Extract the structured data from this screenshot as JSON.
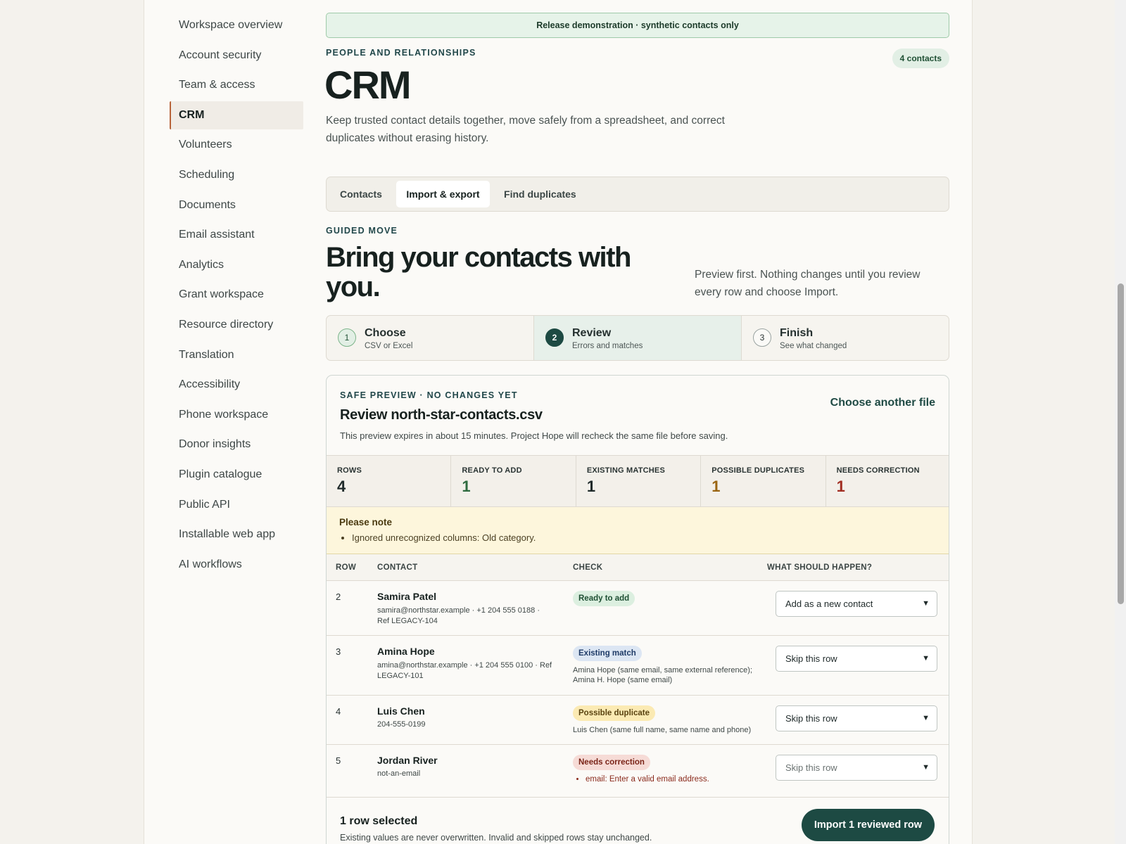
{
  "sidebar": {
    "items": [
      {
        "label": "Workspace overview"
      },
      {
        "label": "Account security"
      },
      {
        "label": "Team & access"
      },
      {
        "label": "CRM"
      },
      {
        "label": "Volunteers"
      },
      {
        "label": "Scheduling"
      },
      {
        "label": "Documents"
      },
      {
        "label": "Email assistant"
      },
      {
        "label": "Analytics"
      },
      {
        "label": "Grant workspace"
      },
      {
        "label": "Resource directory"
      },
      {
        "label": "Translation"
      },
      {
        "label": "Accessibility"
      },
      {
        "label": "Phone workspace"
      },
      {
        "label": "Donor insights"
      },
      {
        "label": "Plugin catalogue"
      },
      {
        "label": "Public API"
      },
      {
        "label": "Installable web app"
      },
      {
        "label": "AI workflows"
      }
    ],
    "active_index": 3
  },
  "banner": "Release demonstration · synthetic contacts only",
  "header": {
    "eyebrow": "PEOPLE AND RELATIONSHIPS",
    "title": "CRM",
    "count_badge": "4 contacts",
    "intro": "Keep trusted contact details together, move safely from a spreadsheet, and correct duplicates without erasing history."
  },
  "tabs": [
    {
      "label": "Contacts"
    },
    {
      "label": "Import & export"
    },
    {
      "label": "Find duplicates"
    }
  ],
  "active_tab_index": 1,
  "guided": {
    "eyebrow": "GUIDED MOVE",
    "title": "Bring your contacts with you.",
    "note": "Preview first. Nothing changes until you review every row and choose Import."
  },
  "steps": [
    {
      "num": "1",
      "title": "Choose",
      "sub": "CSV or Excel"
    },
    {
      "num": "2",
      "title": "Review",
      "sub": "Errors and matches"
    },
    {
      "num": "3",
      "title": "Finish",
      "sub": "See what changed"
    }
  ],
  "current_step_index": 1,
  "preview": {
    "eyebrow": "SAFE PREVIEW · NO CHANGES YET",
    "title": "Review north-star-contacts.csv",
    "sub": "This preview expires in about 15 minutes. Project Hope will recheck the same file before saving.",
    "choose_another": "Choose another file"
  },
  "stats": [
    {
      "label": "ROWS",
      "value": "4",
      "color": "#1f2a2a"
    },
    {
      "label": "READY TO ADD",
      "value": "1",
      "color": "#2f6b3f"
    },
    {
      "label": "EXISTING MATCHES",
      "value": "1",
      "color": "#1f2a2a"
    },
    {
      "label": "POSSIBLE DUPLICATES",
      "value": "1",
      "color": "#9a6512"
    },
    {
      "label": "NEEDS CORRECTION",
      "value": "1",
      "color": "#a12e22"
    }
  ],
  "note": {
    "title": "Please note",
    "items": [
      "Ignored unrecognized columns: Old category."
    ]
  },
  "table": {
    "headers": [
      "ROW",
      "CONTACT",
      "CHECK",
      "WHAT SHOULD HAPPEN?"
    ],
    "rows": [
      {
        "row": "2",
        "name": "Samira Patel",
        "detail": "samira@northstar.example · +1 204 555 0188 · Ref LEGACY-104",
        "status": "Ready to add",
        "check_detail": "",
        "action": "Add as a new contact"
      },
      {
        "row": "3",
        "name": "Amina Hope",
        "detail": "amina@northstar.example · +1 204 555 0100 · Ref LEGACY-101",
        "status": "Existing match",
        "check_detail": "Amina Hope (same email, same external reference); Amina H. Hope (same email)",
        "action": "Skip this row"
      },
      {
        "row": "4",
        "name": "Luis Chen",
        "detail": "204-555-0199",
        "status": "Possible duplicate",
        "check_detail": "Luis Chen (same full name, same name and phone)",
        "action": "Skip this row"
      },
      {
        "row": "5",
        "name": "Jordan River",
        "detail": "not-an-email",
        "status": "Needs correction",
        "check_detail": "email: Enter a valid email address.",
        "action": "Skip this row"
      }
    ]
  },
  "footer": {
    "selected": "1 row selected",
    "sub": "Existing values are never overwritten. Invalid and skipped rows stay unchanged.",
    "import_label": "Import 1 reviewed row"
  },
  "icons": {
    "select_chevron": "chevron-down-icon"
  }
}
